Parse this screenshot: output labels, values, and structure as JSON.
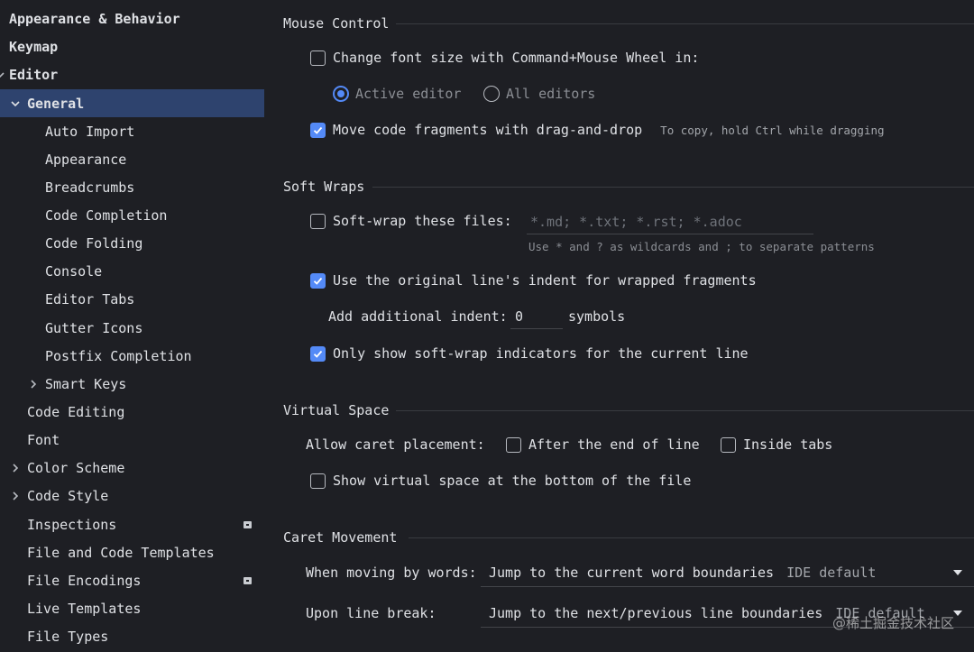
{
  "sidebar": {
    "items": [
      {
        "label": "Appearance & Behavior"
      },
      {
        "label": "Keymap"
      },
      {
        "label": "Editor"
      },
      {
        "label": "General"
      },
      {
        "label": "Auto Import"
      },
      {
        "label": "Appearance"
      },
      {
        "label": "Breadcrumbs"
      },
      {
        "label": "Code Completion"
      },
      {
        "label": "Code Folding"
      },
      {
        "label": "Console"
      },
      {
        "label": "Editor Tabs"
      },
      {
        "label": "Gutter Icons"
      },
      {
        "label": "Postfix Completion"
      },
      {
        "label": "Smart Keys"
      },
      {
        "label": "Code Editing"
      },
      {
        "label": "Font"
      },
      {
        "label": "Color Scheme"
      },
      {
        "label": "Code Style"
      },
      {
        "label": "Inspections"
      },
      {
        "label": "File and Code Templates"
      },
      {
        "label": "File Encodings"
      },
      {
        "label": "Live Templates"
      },
      {
        "label": "File Types"
      }
    ]
  },
  "mouse_control": {
    "title": "Mouse Control",
    "change_font_size": "Change font size with Command+Mouse Wheel in:",
    "active_editor": "Active editor",
    "all_editors": "All editors",
    "move_fragments": "Move code fragments with drag-and-drop",
    "move_hint": "To copy, hold Ctrl while dragging"
  },
  "soft_wraps": {
    "title": "Soft Wraps",
    "soft_wrap_files": "Soft-wrap these files:",
    "files_placeholder": "*.md; *.txt; *.rst; *.adoc",
    "files_hint": "Use * and ? as wildcards and ; to separate patterns",
    "use_original_indent": "Use the original line's indent for wrapped fragments",
    "add_indent_label": "Add additional indent:",
    "add_indent_value": "0",
    "symbols": "symbols",
    "only_show_indicators": "Only show soft-wrap indicators for the current line"
  },
  "virtual_space": {
    "title": "Virtual Space",
    "allow_caret": "Allow caret placement:",
    "after_end": "After the end of line",
    "inside_tabs": "Inside tabs",
    "show_virtual": "Show virtual space at the bottom of the file"
  },
  "caret_movement": {
    "title": "Caret Movement",
    "moving_by_words": "When moving by words:",
    "words_value": "Jump to the current word boundaries",
    "words_default": "IDE default",
    "line_break": "Upon line break:",
    "line_value": "Jump to the next/previous line boundaries",
    "line_default": "IDE default"
  },
  "watermark": "@稀土掘金技术社区",
  "colors": {
    "accent": "#548af7",
    "selection": "#2e436e",
    "background": "#1e1f24"
  }
}
